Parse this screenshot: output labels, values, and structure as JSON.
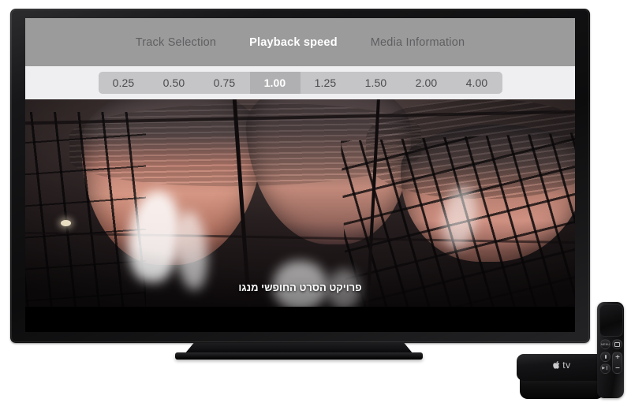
{
  "screen": {
    "tabs": [
      {
        "label": "Track Selection",
        "active": false
      },
      {
        "label": "Playback speed",
        "active": true
      },
      {
        "label": "Media Information",
        "active": false
      }
    ],
    "playback_speeds": [
      {
        "label": "0.25",
        "selected": false
      },
      {
        "label": "0.50",
        "selected": false
      },
      {
        "label": "0.75",
        "selected": false
      },
      {
        "label": "1.00",
        "selected": true
      },
      {
        "label": "1.25",
        "selected": false
      },
      {
        "label": "1.50",
        "selected": false
      },
      {
        "label": "2.00",
        "selected": false
      },
      {
        "label": "4.00",
        "selected": false
      }
    ],
    "subtitle_text": "פרויקט הסרט החופשי מנגו"
  },
  "devices": {
    "apple_tv_label": "tv",
    "remote": {
      "menu_label": "MENU",
      "home_name": "tv-button",
      "mic_name": "siri-mic-button",
      "play_label": "▶❙",
      "volume_up": "+",
      "volume_down": "−"
    }
  },
  "colors": {
    "tab_bar_bg": "#9b9b9c",
    "speed_bar_bg": "#efeff1",
    "speed_strip_bg": "#c5c5c7",
    "selected_pill_bg": "#b0b0b2",
    "selected_text": "#ffffff",
    "inactive_tab_text": "#5f5f61",
    "bezel": "#0c0c0d",
    "page_bg": "#ffffff"
  }
}
